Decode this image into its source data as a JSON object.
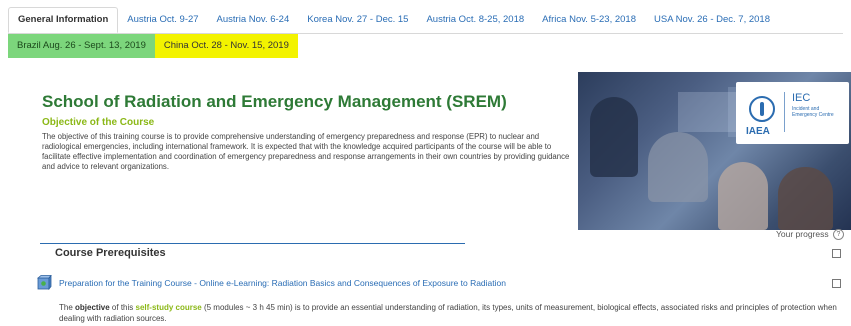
{
  "tabs_row1": [
    {
      "label": "General Information",
      "active": true
    },
    {
      "label": "Austria Oct. 9-27"
    },
    {
      "label": "Austria Nov. 6-24"
    },
    {
      "label": "Korea Nov. 27 - Dec. 15"
    },
    {
      "label": "Austria Oct. 8-25, 2018"
    },
    {
      "label": "Africa Nov. 5-23, 2018"
    },
    {
      "label": "USA Nov. 26 - Dec. 7, 2018"
    }
  ],
  "tabs_row2": [
    {
      "label": "Brazil Aug. 26 - Sept. 13, 2019",
      "color": "#7cd67c"
    },
    {
      "label": "China Oct. 28 - Nov. 15, 2019",
      "color": "#f3f300"
    }
  ],
  "page_title": "School of Radiation and Emergency Management (SREM)",
  "objective_heading": "Objective of the Course",
  "objective_text": "The objective of this training course is to provide comprehensive understanding of emergency preparedness and response (EPR) to nuclear and radiological emergencies, including international framework. It is expected that with the knowledge acquired participants of the course will be able to facilitate effective implementation and coordination of emergency preparedness and response arrangements in their own countries by providing guidance and advice to relevant organizations.",
  "banner_logo": {
    "org": "IAEA",
    "unit": "IEC",
    "unit_sub": "Incident and Emergency Centre"
  },
  "progress_label": "Your progress",
  "section_heading": "Course Prerequisites",
  "activity": {
    "icon": "scorm-package-icon",
    "title": "Preparation for the Training Course - Online e-Learning: Radiation Basics and Consequences of Exposure to Radiation"
  },
  "description": {
    "prefix": "The ",
    "bold1": "objective",
    "mid1": " of this ",
    "bold2": "self-study course",
    "rest": " (5 modules ~ 3 h 45 min) is to provide an essential understanding of radiation, its types, units of measurement, biological effects, associated risks and principles of protection when dealing with radiation sources."
  },
  "colors": {
    "title": "#2e7a36",
    "subtitle": "#8bb817",
    "link": "#2a6db5"
  }
}
